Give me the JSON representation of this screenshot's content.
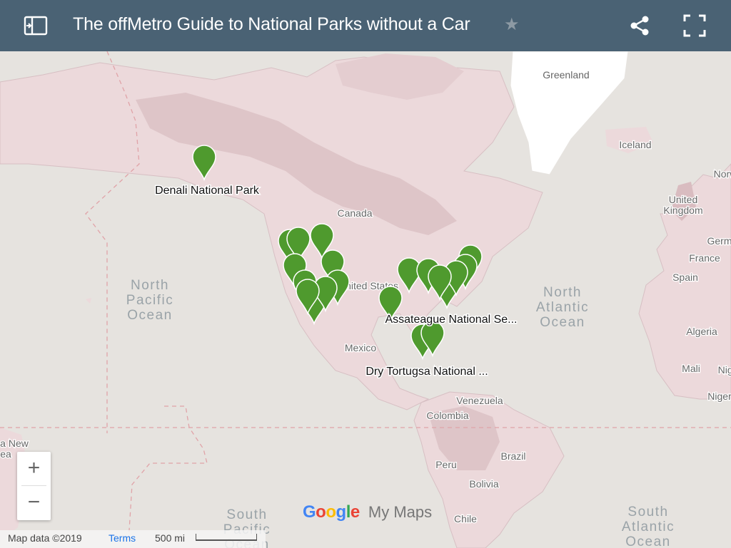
{
  "header": {
    "title": "The offMetro Guide to National Parks without a Car",
    "colors": {
      "bar": "#4a6274",
      "text": "#ffffff"
    }
  },
  "map": {
    "colors": {
      "ocean": "#e6e3df",
      "land": "#ecd9db",
      "land_dark": "#d9bcc0",
      "greenland": "#ffffff",
      "marker": "#4f9a2e"
    },
    "region_labels": [
      {
        "id": "greenland",
        "text": "Greenland"
      },
      {
        "id": "iceland",
        "text": "Iceland"
      },
      {
        "id": "norway",
        "text": "Norw"
      },
      {
        "id": "uk1",
        "text": "United"
      },
      {
        "id": "uk2",
        "text": "Kingdom"
      },
      {
        "id": "germany",
        "text": "Germ"
      },
      {
        "id": "france",
        "text": "France"
      },
      {
        "id": "spain",
        "text": "Spain"
      },
      {
        "id": "algeria",
        "text": "Algeria"
      },
      {
        "id": "mali",
        "text": "Mali"
      },
      {
        "id": "niger",
        "text": "Nige"
      },
      {
        "id": "nigeria",
        "text": "Niger"
      },
      {
        "id": "canada",
        "text": "Canada"
      },
      {
        "id": "us",
        "text": "United States"
      },
      {
        "id": "mexico",
        "text": "Mexico"
      },
      {
        "id": "venezuela",
        "text": "Venezuela"
      },
      {
        "id": "colombia",
        "text": "Colombia"
      },
      {
        "id": "brazil",
        "text": "Brazil"
      },
      {
        "id": "peru",
        "text": "Peru"
      },
      {
        "id": "bolivia",
        "text": "Bolivia"
      },
      {
        "id": "chile",
        "text": "Chile"
      },
      {
        "id": "newzealand1",
        "text": "a New"
      },
      {
        "id": "newzealand2",
        "text": "ea"
      }
    ],
    "ocean_labels": [
      {
        "id": "np1",
        "text": "North"
      },
      {
        "id": "np2",
        "text": "Pacific"
      },
      {
        "id": "np3",
        "text": "Ocean"
      },
      {
        "id": "na1",
        "text": "North"
      },
      {
        "id": "na2",
        "text": "Atlantic"
      },
      {
        "id": "na3",
        "text": "Ocean"
      },
      {
        "id": "sp1",
        "text": "South"
      },
      {
        "id": "sp2",
        "text": "Pacific"
      },
      {
        "id": "sp3",
        "text": "Ocean"
      },
      {
        "id": "sa1",
        "text": "South"
      },
      {
        "id": "sa2",
        "text": "Atlantic"
      },
      {
        "id": "sa3",
        "text": "Ocean"
      }
    ],
    "place_labels": [
      {
        "id": "denali",
        "text": "Denali National Park"
      },
      {
        "id": "assateague",
        "text": "Assateague National Se..."
      },
      {
        "id": "tortugas",
        "text": "Dry Tortugsa National ..."
      }
    ]
  },
  "controls": {
    "zoom_in": "+",
    "zoom_out": "−"
  },
  "attribution": {
    "map_data": "Map data ©2019",
    "terms": "Terms",
    "scale": "500 mi"
  },
  "logo": {
    "google": "Google",
    "my_maps": "My Maps"
  }
}
